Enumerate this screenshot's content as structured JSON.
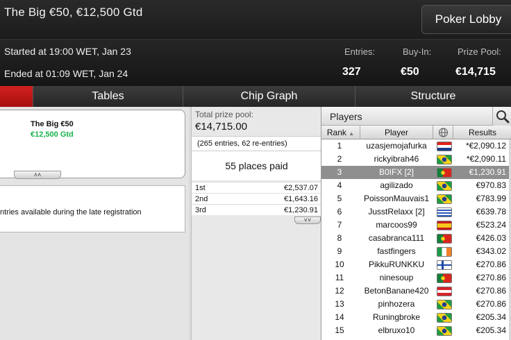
{
  "header": {
    "title": "The Big €50, €12,500 Gtd",
    "lobby_button": "Poker Lobby",
    "started": "Started at 19:00 WET, Jan 23",
    "ended": "Ended at 01:09 WET, Jan 24",
    "stats": {
      "entries_label": "Entries:",
      "entries": "327",
      "buyin_label": "Buy-In:",
      "buyin": "€50",
      "prizepool_label": "Prize Pool:",
      "prizepool": "€14,715"
    }
  },
  "tabs": [
    {
      "label": ""
    },
    {
      "label": "Tables"
    },
    {
      "label": "Chip Graph"
    },
    {
      "label": "Structure"
    }
  ],
  "left": {
    "card_name": "The Big €50",
    "card_gtd": "€12,500 Gtd",
    "note": "ntries available during the late registration"
  },
  "prizes": {
    "pool_label": "Total prize pool:",
    "pool_value": "€14,715.00",
    "entries_note": "(265 entries, 62 re-entries)",
    "places_paid": "55 places paid",
    "places": [
      {
        "place": "1st",
        "amount": "€2,537.07"
      },
      {
        "place": "2nd",
        "amount": "€1,643.16"
      },
      {
        "place": "3rd",
        "amount": "€1,230.91"
      }
    ]
  },
  "players": {
    "title": "Players",
    "columns": {
      "rank": "Rank",
      "player": "Player",
      "results": "Results"
    },
    "rows": [
      {
        "rank": "1",
        "name": "uzasjemojafurka",
        "flag": "hr",
        "result": "*€2,090.12"
      },
      {
        "rank": "2",
        "name": "rickyibrah46",
        "flag": "br",
        "result": "*€2,090.11"
      },
      {
        "rank": "3",
        "name": "B0IFX [2]",
        "flag": "pt",
        "result": "€1,230.91",
        "selected": true
      },
      {
        "rank": "4",
        "name": "agilizado",
        "flag": "br",
        "result": "€970.83"
      },
      {
        "rank": "5",
        "name": "PoissonMauvais1",
        "flag": "br",
        "result": "€783.99"
      },
      {
        "rank": "6",
        "name": "JusstRelaxx [2]",
        "flag": "uy",
        "result": "€639.78"
      },
      {
        "rank": "7",
        "name": "marcoos99",
        "flag": "es",
        "result": "€523.24"
      },
      {
        "rank": "8",
        "name": "casabranca111",
        "flag": "pt",
        "result": "€426.03"
      },
      {
        "rank": "9",
        "name": "fastfingers",
        "flag": "ie",
        "result": "€343.02"
      },
      {
        "rank": "10",
        "name": "PikkuRUNKKU",
        "flag": "fi",
        "result": "€270.86"
      },
      {
        "rank": "11",
        "name": "ninesoup",
        "flag": "pt",
        "result": "€270.86"
      },
      {
        "rank": "12",
        "name": "BetonBanane420",
        "flag": "at",
        "result": "€270.86"
      },
      {
        "rank": "13",
        "name": "pinhozera",
        "flag": "br",
        "result": "€270.86"
      },
      {
        "rank": "14",
        "name": "Runingbroke",
        "flag": "br",
        "result": "€205.34"
      },
      {
        "rank": "15",
        "name": "elbruxo10",
        "flag": "br",
        "result": "€205.34"
      }
    ]
  }
}
